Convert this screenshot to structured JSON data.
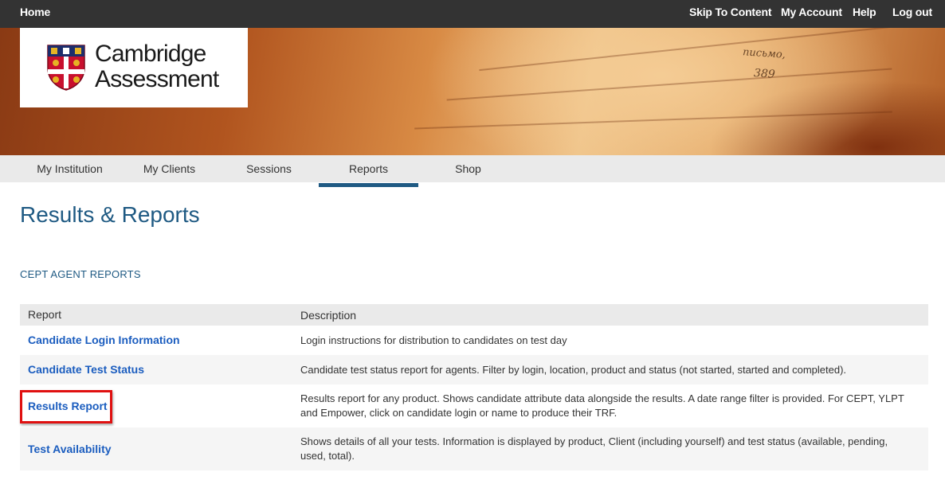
{
  "topbar": {
    "home": "Home",
    "skip": "Skip To Content",
    "account": "My Account",
    "help": "Help",
    "logout": "Log out"
  },
  "logo": {
    "line1": "Cambridge",
    "line2": "Assessment"
  },
  "banner": {
    "page_word": "письмо,",
    "page_number": "389"
  },
  "nav": {
    "tabs": [
      "My Institution",
      "My Clients",
      "Sessions",
      "Reports",
      "Shop"
    ],
    "active": "Reports"
  },
  "page_title": "Results & Reports",
  "section_title": "CEPT AGENT REPORTS",
  "table": {
    "headers": [
      "Report",
      "Description"
    ],
    "rows": [
      {
        "report": "Candidate Login Information",
        "description": "Login instructions for distribution to candidates on test day"
      },
      {
        "report": "Candidate Test Status",
        "description": "Candidate test status report for agents. Filter by login, location, product and status (not started, started and completed)."
      },
      {
        "report": "Results Report",
        "description": "Results report for any product. Shows candidate attribute data alongside the results. A date range filter is provided. For CEPT, YLPT and Empower, click on candidate login or name to produce their TRF."
      },
      {
        "report": "Test Availability",
        "description": "Shows details of all your tests. Information is displayed by product, Client (including yourself) and test status (available, pending, used, total)."
      }
    ]
  },
  "colors": {
    "topbar": "#333333",
    "brand_blue": "#1f5a83",
    "link": "#1b5dbf",
    "highlight": "#e01010"
  }
}
